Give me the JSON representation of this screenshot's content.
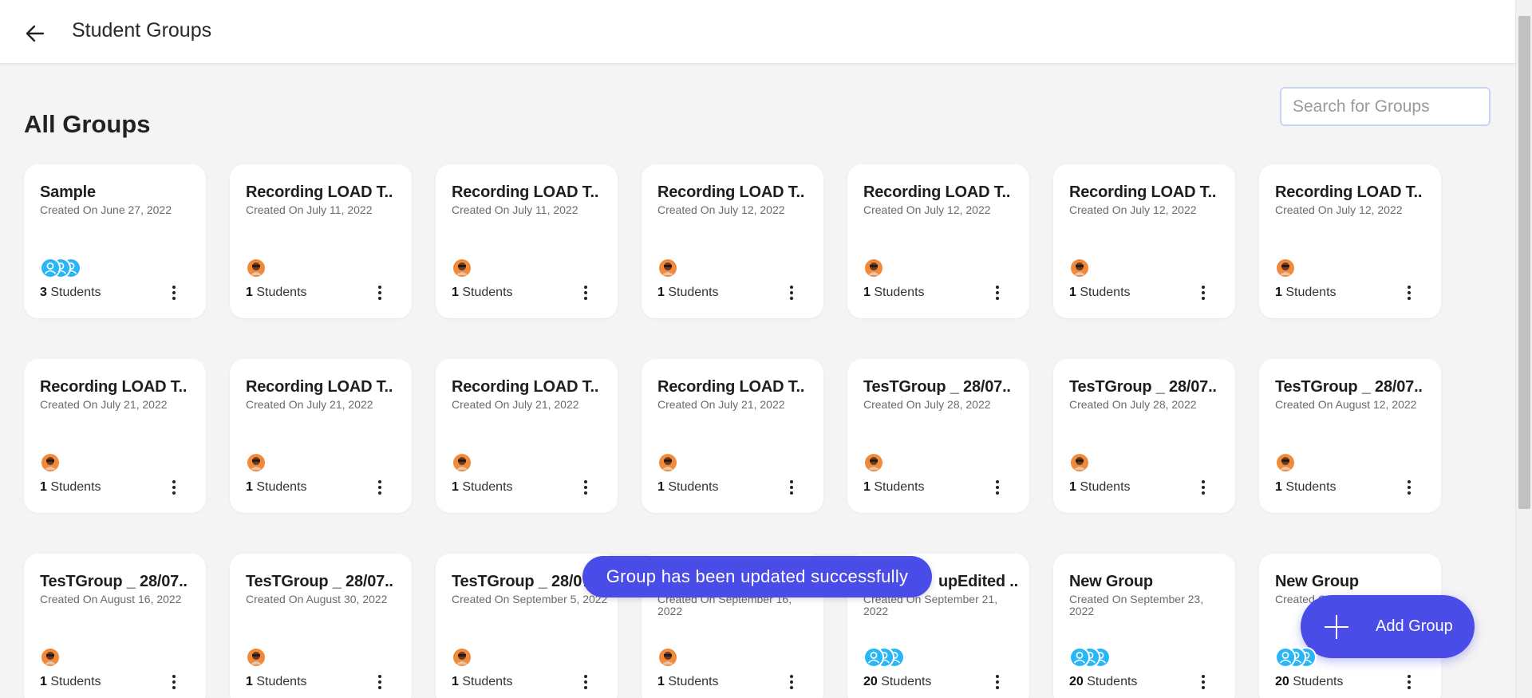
{
  "header": {
    "title": "Student Groups"
  },
  "section": {
    "title": "All Groups"
  },
  "search": {
    "placeholder": "Search for Groups"
  },
  "groups": [
    {
      "name": "Sample",
      "created": "Created On June 27, 2022",
      "count": "3",
      "count_label": "Students",
      "avatar": "group"
    },
    {
      "name": "Recording LOAD T..",
      "created": "Created On July 11, 2022",
      "count": "1",
      "count_label": "Students",
      "avatar": "user"
    },
    {
      "name": "Recording LOAD T..",
      "created": "Created On July 11, 2022",
      "count": "1",
      "count_label": "Students",
      "avatar": "user"
    },
    {
      "name": "Recording LOAD T..",
      "created": "Created On July 12, 2022",
      "count": "1",
      "count_label": "Students",
      "avatar": "user"
    },
    {
      "name": "Recording LOAD T..",
      "created": "Created On July 12, 2022",
      "count": "1",
      "count_label": "Students",
      "avatar": "user"
    },
    {
      "name": "Recording LOAD T..",
      "created": "Created On July 12, 2022",
      "count": "1",
      "count_label": "Students",
      "avatar": "user"
    },
    {
      "name": "Recording LOAD T..",
      "created": "Created On July 12, 2022",
      "count": "1",
      "count_label": "Students",
      "avatar": "user"
    },
    {
      "name": "Recording LOAD T..",
      "created": "Created On July 21, 2022",
      "count": "1",
      "count_label": "Students",
      "avatar": "user"
    },
    {
      "name": "Recording LOAD T..",
      "created": "Created On July 21, 2022",
      "count": "1",
      "count_label": "Students",
      "avatar": "user"
    },
    {
      "name": "Recording LOAD T..",
      "created": "Created On July 21, 2022",
      "count": "1",
      "count_label": "Students",
      "avatar": "user"
    },
    {
      "name": "Recording LOAD T..",
      "created": "Created On July 21, 2022",
      "count": "1",
      "count_label": "Students",
      "avatar": "user"
    },
    {
      "name": "TesTGroup _ 28/07..",
      "created": "Created On July 28, 2022",
      "count": "1",
      "count_label": "Students",
      "avatar": "user"
    },
    {
      "name": "TesTGroup _ 28/07..",
      "created": "Created On July 28, 2022",
      "count": "1",
      "count_label": "Students",
      "avatar": "user"
    },
    {
      "name": "TesTGroup _ 28/07..",
      "created": "Created On August 12, 2022",
      "count": "1",
      "count_label": "Students",
      "avatar": "user"
    },
    {
      "name": "TesTGroup _ 28/07..",
      "created": "Created On August 16, 2022",
      "count": "1",
      "count_label": "Students",
      "avatar": "user"
    },
    {
      "name": "TesTGroup _ 28/07..",
      "created": "Created On August 30, 2022",
      "count": "1",
      "count_label": "Students",
      "avatar": "user"
    },
    {
      "name": "TesTGroup _ 28/07..",
      "created": "Created On September 5, 2022",
      "count": "1",
      "count_label": "Students",
      "avatar": "user"
    },
    {
      "name": "",
      "created": "Created On September 16, 2022",
      "count": "1",
      "count_label": "Students",
      "avatar": "user"
    },
    {
      "name": "upEdited ..",
      "created": "Created On September 21, 2022",
      "count": "20",
      "count_label": "Students",
      "avatar": "group"
    },
    {
      "name": "New Group",
      "created": "Created On September 23, 2022",
      "count": "20",
      "count_label": "Students",
      "avatar": "group"
    },
    {
      "name": "New Group",
      "created": "Created On",
      "count": "20",
      "count_label": "Students",
      "avatar": "group"
    }
  ],
  "toast": {
    "message": "Group has been updated successfully"
  },
  "fab": {
    "label": "Add Group"
  },
  "colors": {
    "accent": "#4a4ce8",
    "group_avatar": "#29b6f6",
    "user_avatar": "#f08a3c",
    "background": "#f4f4f4"
  },
  "icons": {
    "back": "arrow-left-icon",
    "add": "plus-icon",
    "menu": "more-vertical-icon",
    "user": "user-avatar-icon",
    "group": "group-avatar-icon"
  }
}
